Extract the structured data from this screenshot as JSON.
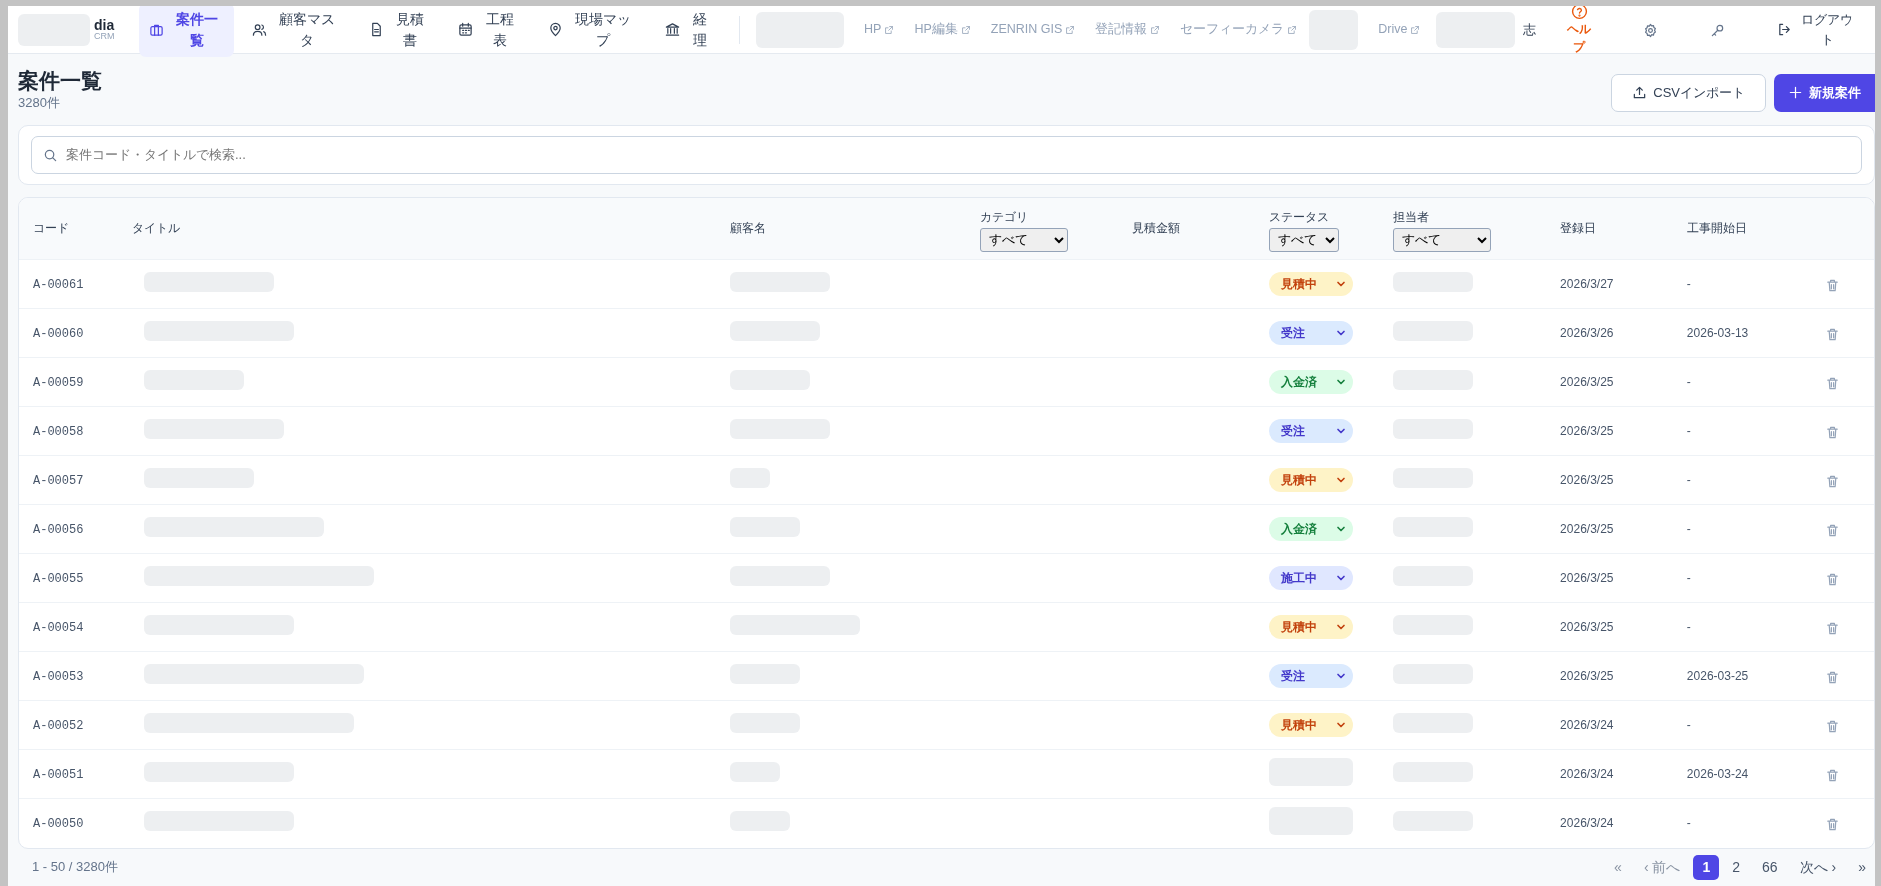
{
  "nav": {
    "brand": "dia",
    "brand_sub": "CRM",
    "items": [
      {
        "label": "案件一覧",
        "selected": true
      },
      {
        "label": "顧客マスタ",
        "selected": false
      },
      {
        "label": "見積書",
        "selected": false
      },
      {
        "label": "工程表",
        "selected": false
      },
      {
        "label": "現場マップ",
        "selected": false
      },
      {
        "label": "経理",
        "selected": false
      }
    ],
    "links": [
      "HP",
      "HP編集",
      "ZENRIN GIS",
      "登記情報",
      "セーフィーカメラ",
      "Drive"
    ],
    "user": "志",
    "help": "ヘルプ",
    "logout": "ログアウト"
  },
  "page": {
    "title": "案件一覧",
    "count": "3280件",
    "import_button": "CSVインポート",
    "new_button": "新規案件"
  },
  "search": {
    "placeholder": "案件コード・タイトルで検索..."
  },
  "table": {
    "columns": [
      {
        "label": "コード"
      },
      {
        "label": "タイトル"
      },
      {
        "label": "顧客名"
      },
      {
        "label": "カテゴリ",
        "filter": "すべて"
      },
      {
        "label": "見積金額"
      },
      {
        "label": "ステータス",
        "filter": "すべて"
      },
      {
        "label": "担当者",
        "filter": "すべて"
      },
      {
        "label": "登録日"
      },
      {
        "label": "工事開始日"
      }
    ],
    "rows": [
      {
        "code": "A-00061",
        "status": "見積中",
        "kind": "estimate",
        "registered": "2026/3/27",
        "start": "-"
      },
      {
        "code": "A-00060",
        "status": "受注",
        "kind": "order",
        "registered": "2026/3/26",
        "start": "2026-03-13"
      },
      {
        "code": "A-00059",
        "status": "入金済",
        "kind": "paid",
        "registered": "2026/3/25",
        "start": "-"
      },
      {
        "code": "A-00058",
        "status": "受注",
        "kind": "order",
        "registered": "2026/3/25",
        "start": "-"
      },
      {
        "code": "A-00057",
        "status": "見積中",
        "kind": "estimate",
        "registered": "2026/3/25",
        "start": "-"
      },
      {
        "code": "A-00056",
        "status": "入金済",
        "kind": "paid",
        "registered": "2026/3/25",
        "start": "-"
      },
      {
        "code": "A-00055",
        "status": "施工中",
        "kind": "construction",
        "registered": "2026/3/25",
        "start": "-"
      },
      {
        "code": "A-00054",
        "status": "見積中",
        "kind": "estimate",
        "registered": "2026/3/25",
        "start": "-"
      },
      {
        "code": "A-00053",
        "status": "受注",
        "kind": "order",
        "registered": "2026/3/25",
        "start": "2026-03-25"
      },
      {
        "code": "A-00052",
        "status": "見積中",
        "kind": "estimate",
        "registered": "2026/3/24",
        "start": "-"
      },
      {
        "code": "A-00051",
        "registered": "2026/3/24",
        "start": "2026-03-24"
      },
      {
        "code": "A-00050",
        "registered": "2026/3/24",
        "start": "-"
      }
    ]
  },
  "pagination": {
    "summary": "1 - 50 / 3280件",
    "items": [
      {
        "label": "«",
        "selected": false,
        "disabled": true
      },
      {
        "label": "‹ 前へ",
        "selected": false,
        "disabled": true
      },
      {
        "label": "1",
        "selected": true,
        "disabled": false
      },
      {
        "label": "2",
        "selected": false,
        "disabled": false
      },
      {
        "label": "66",
        "selected": false,
        "disabled": false
      },
      {
        "label": "次へ ›",
        "selected": false,
        "disabled": false
      },
      {
        "label": "»",
        "selected": false,
        "disabled": false
      }
    ]
  }
}
